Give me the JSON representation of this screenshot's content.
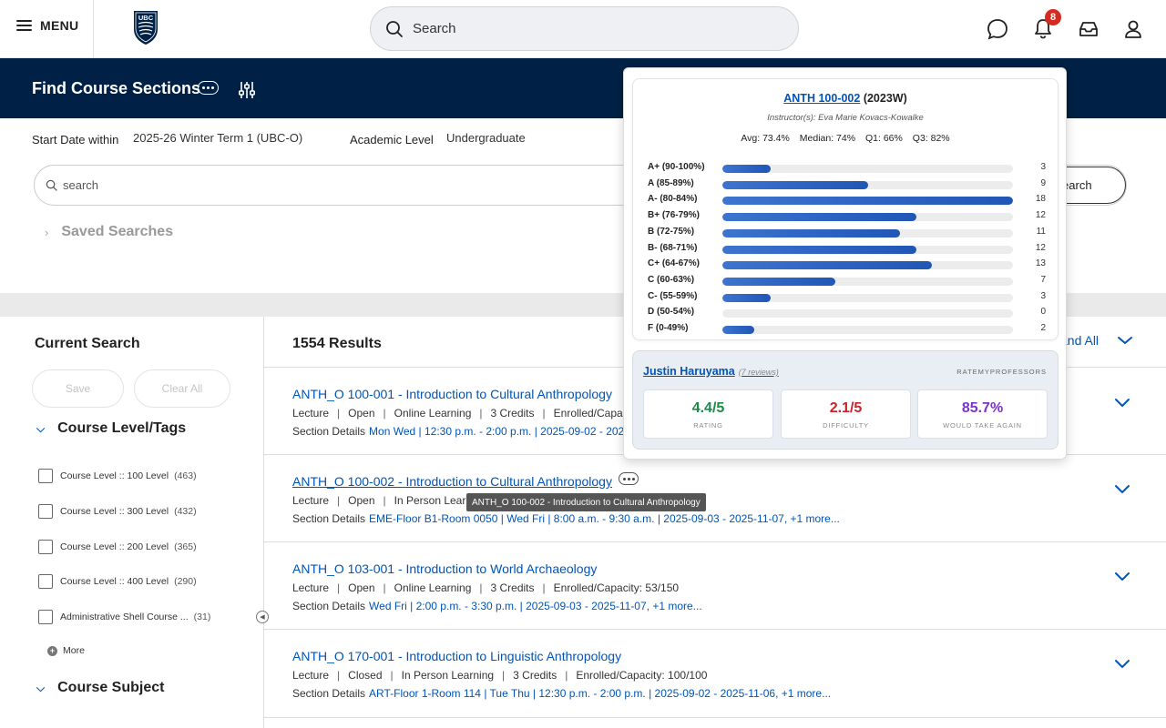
{
  "topbar": {
    "menu_label": "MENU",
    "logo_text": "UBC",
    "search_placeholder": "Search",
    "notification_count": "8",
    "icons": [
      "chat-icon",
      "bell-icon",
      "inbox-icon",
      "user-icon"
    ]
  },
  "header": {
    "title": "Find Course Sections"
  },
  "filters": {
    "start_date_label": "Start Date within",
    "start_date_value": "2025-26 Winter Term 1 (UBC-O)",
    "academic_level_label": "Academic Level",
    "academic_level_value": "Undergraduate",
    "search_placeholder": "search",
    "search_button": "Search",
    "saved_searches": "Saved Searches"
  },
  "sidebar": {
    "title": "Current Search",
    "save_label": "Save",
    "clear_label": "Clear All",
    "course_level_heading": "Course Level/Tags",
    "course_levels": [
      {
        "label": "Course Level :: 100 Level",
        "count": "(463)"
      },
      {
        "label": "Course Level :: 300 Level",
        "count": "(432)"
      },
      {
        "label": "Course Level :: 200 Level",
        "count": "(365)"
      },
      {
        "label": "Course Level :: 400 Level",
        "count": "(290)"
      },
      {
        "label": "Administrative Shell Course ...",
        "count": "(31)"
      }
    ],
    "more_label": "More",
    "course_subject_heading": "Course Subject"
  },
  "results": {
    "count": "1554 Results",
    "expand_all": "and All",
    "details_label": "Section Details",
    "items": [
      {
        "title": "ANTH_O 100-001 - Introduction to Cultural Anthropology",
        "meta": [
          "Lecture",
          "Open",
          "Online Learning",
          "3 Credits",
          "Enrolled/Capacity"
        ],
        "details": "Mon Wed | 12:30 p.m. - 2:00 p.m. | 2025-09-02 - 2025-11"
      },
      {
        "title": "ANTH_O 100-002 - Introduction to Cultural Anthropology",
        "meta": [
          "Lecture",
          "Open",
          "In Person Learnin"
        ],
        "details": "EME-Floor B1-Room 0050 | Wed Fri | 8:00 a.m. - 9:30 a.m. | 2025-09-03 - 2025-11-07, +1 more..."
      },
      {
        "title": "ANTH_O 103-001 - Introduction to World Archaeology",
        "meta": [
          "Lecture",
          "Open",
          "Online Learning",
          "3 Credits",
          "Enrolled/Capacity: 53/150"
        ],
        "details": "Wed Fri | 2:00 p.m. - 3:30 p.m. | 2025-09-03 - 2025-11-07, +1 more..."
      },
      {
        "title": "ANTH_O 170-001 - Introduction to Linguistic Anthropology",
        "meta": [
          "Lecture",
          "Closed",
          "In Person Learning",
          "3 Credits",
          "Enrolled/Capacity: 100/100"
        ],
        "details": "ART-Floor 1-Room 114 | Tue Thu | 12:30 p.m. - 2:00 p.m. | 2025-09-02 - 2025-11-06, +1 more..."
      }
    ],
    "tooltip": "ANTH_O 100-002 - Introduction to Cultural Anthropology"
  },
  "popup": {
    "course_code": "ANTH 100-002",
    "term": "(2023W)",
    "instructors": "Instructor(s): Eva Marie Kovacs-Kowalke",
    "stats": [
      "Avg: 73.4%",
      "Median: 74%",
      "Q1: 66%",
      "Q3: 82%"
    ],
    "max_count": 18,
    "grades": [
      {
        "label": "A+ (90-100%)",
        "count": 3
      },
      {
        "label": "A (85-89%)",
        "count": 9
      },
      {
        "label": "A- (80-84%)",
        "count": 18
      },
      {
        "label": "B+ (76-79%)",
        "count": 12
      },
      {
        "label": "B (72-75%)",
        "count": 11
      },
      {
        "label": "B- (68-71%)",
        "count": 12
      },
      {
        "label": "C+ (64-67%)",
        "count": 13
      },
      {
        "label": "C (60-63%)",
        "count": 7
      },
      {
        "label": "C- (55-59%)",
        "count": 3
      },
      {
        "label": "D (50-54%)",
        "count": 0
      },
      {
        "label": "F (0-49%)",
        "count": 2
      }
    ],
    "rmp": {
      "name": "Justin Haruyama",
      "reviews": "(7 reviews)",
      "source": "RATEMYPROFESSORS",
      "rating": "4.4/5",
      "rating_label": "RATING",
      "difficulty": "2.1/5",
      "difficulty_label": "DIFFICULTY",
      "take_again": "85.7%",
      "take_again_label": "WOULD TAKE AGAIN"
    }
  },
  "colors": {
    "navy": "#002145",
    "link": "#0055b7",
    "rating_green": "#1e8a4a",
    "difficulty_red": "#c8232b",
    "take_again_purple": "#7a34c9"
  }
}
